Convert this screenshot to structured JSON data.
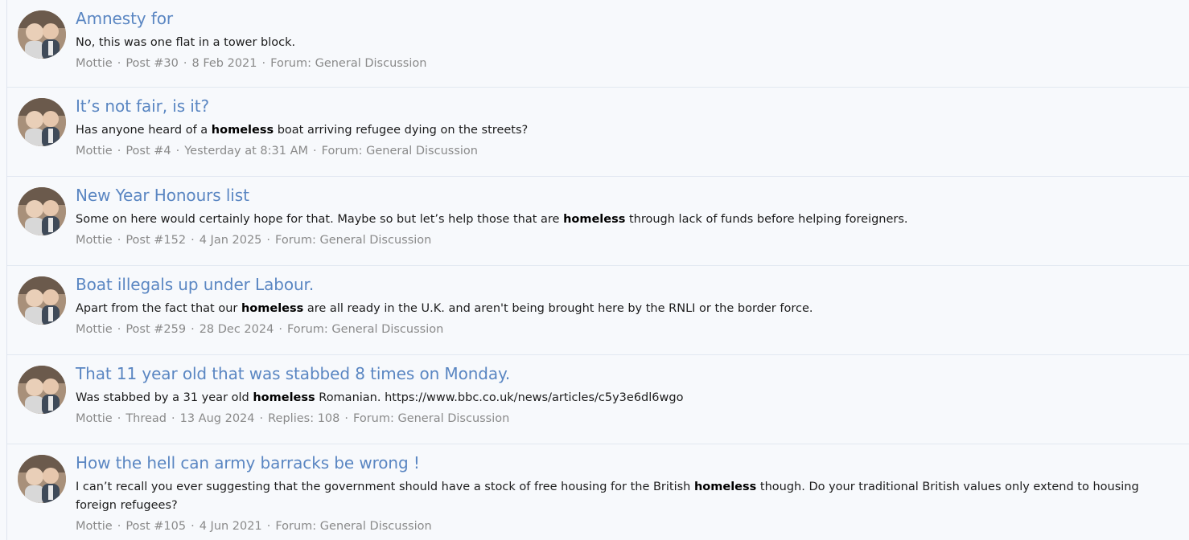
{
  "results": [
    {
      "title": "Amnesty for",
      "snippet_before": "No, this was one flat in a tower block.",
      "keyword": "",
      "snippet_after": "",
      "author": "Mottie",
      "type": "Post #30",
      "date": "8 Feb 2021",
      "extra": "",
      "forum": "Forum: General Discussion"
    },
    {
      "title": "It’s not fair, is it?",
      "snippet_before": "Has anyone heard of a ",
      "keyword": "homeless",
      "snippet_after": " boat arriving refugee dying on the streets?",
      "author": "Mottie",
      "type": "Post #4",
      "date": "Yesterday at 8:31 AM",
      "extra": "",
      "forum": "Forum: General Discussion"
    },
    {
      "title": "New Year Honours list",
      "snippet_before": "Some on here would certainly hope for that. Maybe so but let’s help those that are ",
      "keyword": "homeless",
      "snippet_after": " through lack of funds before helping foreigners.",
      "author": "Mottie",
      "type": "Post #152",
      "date": "4 Jan 2025",
      "extra": "",
      "forum": "Forum: General Discussion"
    },
    {
      "title": "Boat illegals up under Labour.",
      "snippet_before": "Apart from the fact that our ",
      "keyword": "homeless",
      "snippet_after": " are all ready in the U.K. and aren't being brought here by the RNLI or the border force.",
      "author": "Mottie",
      "type": "Post #259",
      "date": "28 Dec 2024",
      "extra": "",
      "forum": "Forum: General Discussion"
    },
    {
      "title": "That 11 year old that was stabbed 8 times on Monday.",
      "snippet_before": "Was stabbed by a 31 year old ",
      "keyword": "homeless",
      "snippet_after": " Romanian. https://www.bbc.co.uk/news/articles/c5y3e6dl6wgo",
      "author": "Mottie",
      "type": "Thread",
      "date": "13 Aug 2024",
      "extra": "Replies: 108",
      "forum": "Forum: General Discussion"
    },
    {
      "title": "How the hell can army barracks be wrong !",
      "snippet_before": "I can’t recall you ever suggesting that the government should have a stock of free housing for the British ",
      "keyword": "homeless",
      "snippet_after": " though. Do your traditional British values only extend to housing foreign refugees?",
      "author": "Mottie",
      "type": "Post #105",
      "date": "4 Jun 2021",
      "extra": "",
      "forum": "Forum: General Discussion"
    }
  ]
}
